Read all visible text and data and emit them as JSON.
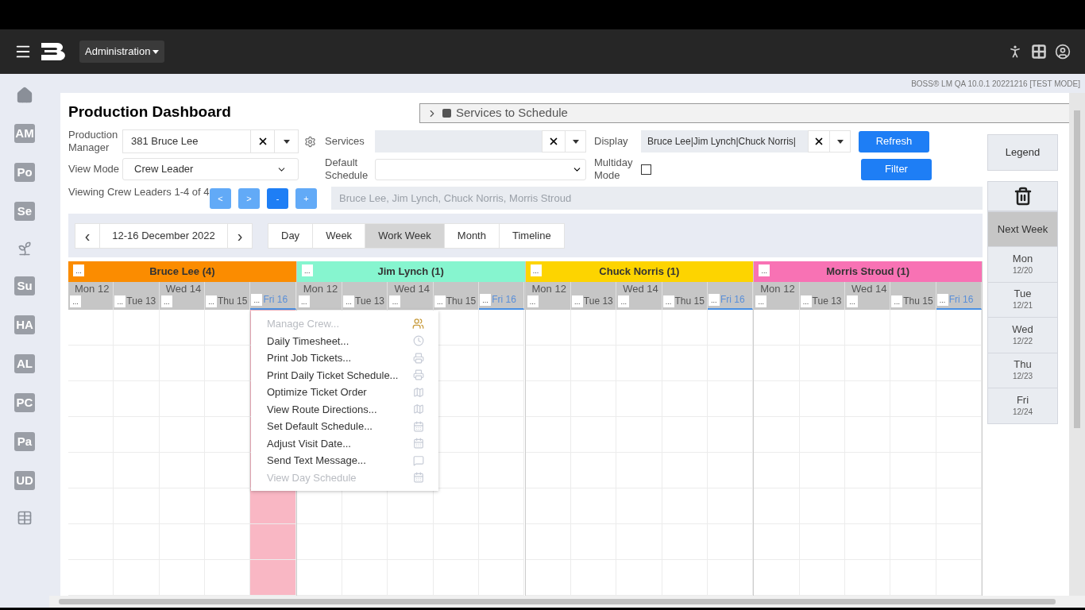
{
  "nav": {
    "menu": "Administration"
  },
  "version": "BOSS® LM QA 10.0.1 20221216 [TEST MODE]",
  "sidebar": [
    {
      "kind": "home"
    },
    {
      "kind": "text",
      "label": "AM"
    },
    {
      "kind": "text",
      "label": "Po"
    },
    {
      "kind": "text",
      "label": "Se"
    },
    {
      "kind": "sprout"
    },
    {
      "kind": "text",
      "label": "Su"
    },
    {
      "kind": "text",
      "label": "HA"
    },
    {
      "kind": "text",
      "label": "AL"
    },
    {
      "kind": "text",
      "label": "PC"
    },
    {
      "kind": "text",
      "label": "Pa"
    },
    {
      "kind": "text",
      "label": "UD"
    },
    {
      "kind": "grid"
    }
  ],
  "title": "Production Dashboard",
  "services_panel": {
    "title": "Services to Schedule",
    "expanded": false
  },
  "form": {
    "production_manager": {
      "label": "Production Manager",
      "value": "381 Bruce Lee"
    },
    "view_mode": {
      "label": "View Mode",
      "value": "Crew Leader"
    },
    "services": {
      "label": "Services"
    },
    "default_schedule": {
      "label": "Default Schedule"
    },
    "display": {
      "label": "Display",
      "value": "Bruce Lee|Jim Lynch|Chuck Norris|"
    },
    "multiday": {
      "label": "Multiday Mode",
      "checked": false
    },
    "refresh": "Refresh",
    "filter": "Filter"
  },
  "viewing": {
    "text": "Viewing Crew Leaders 1-4 of 4",
    "buttons": [
      {
        "label": "<",
        "kind": "light"
      },
      {
        "label": ">",
        "kind": "light"
      },
      {
        "label": "-",
        "kind": "dark"
      },
      {
        "label": "+",
        "kind": "light"
      }
    ],
    "names": "Bruce Lee, Jim Lynch, Chuck Norris, Morris Stroud"
  },
  "date_nav": {
    "prev": "‹",
    "range": "12-16 December 2022",
    "next": "›"
  },
  "views": [
    {
      "label": "Day",
      "selected": false
    },
    {
      "label": "Week",
      "selected": false
    },
    {
      "label": "Work Week",
      "selected": true
    },
    {
      "label": "Month",
      "selected": false
    },
    {
      "label": "Timeline",
      "selected": false
    }
  ],
  "crews": [
    {
      "name": "Bruce Lee (4)",
      "color": "#fb8c00",
      "days": [
        {
          "label": "Mon 12",
          "kind": "below",
          "selected": false,
          "highlighted": false
        },
        {
          "label": "Tue 13",
          "kind": "before",
          "selected": false,
          "highlighted": false
        },
        {
          "label": "Wed 14",
          "kind": "below",
          "selected": false,
          "highlighted": false
        },
        {
          "label": "Thu 15",
          "kind": "before",
          "selected": false,
          "highlighted": false
        },
        {
          "label": "Fri 16",
          "kind": "before",
          "selected": true,
          "highlighted": true
        }
      ]
    },
    {
      "name": "Jim Lynch (1)",
      "color": "#86f5cf",
      "days": [
        {
          "label": "Mon 12",
          "kind": "below",
          "selected": false,
          "highlighted": false
        },
        {
          "label": "Tue 13",
          "kind": "before",
          "selected": false,
          "highlighted": false
        },
        {
          "label": "Wed 14",
          "kind": "below",
          "selected": false,
          "highlighted": false
        },
        {
          "label": "Thu 15",
          "kind": "before",
          "selected": false,
          "highlighted": false
        },
        {
          "label": "Fri 16",
          "kind": "before",
          "selected": true,
          "highlighted": false
        }
      ]
    },
    {
      "name": "Chuck Norris (1)",
      "color": "#fdd400",
      "days": [
        {
          "label": "Mon 12",
          "kind": "below",
          "selected": false,
          "highlighted": false
        },
        {
          "label": "Tue 13",
          "kind": "before",
          "selected": false,
          "highlighted": false
        },
        {
          "label": "Wed 14",
          "kind": "below",
          "selected": false,
          "highlighted": false
        },
        {
          "label": "Thu 15",
          "kind": "before",
          "selected": false,
          "highlighted": false
        },
        {
          "label": "Fri 16",
          "kind": "before",
          "selected": true,
          "highlighted": false
        }
      ]
    },
    {
      "name": "Morris Stroud (1)",
      "color": "#f872b4",
      "days": [
        {
          "label": "Mon 12",
          "kind": "below",
          "selected": false,
          "highlighted": false
        },
        {
          "label": "Tue 13",
          "kind": "before",
          "selected": false,
          "highlighted": false
        },
        {
          "label": "Wed 14",
          "kind": "below",
          "selected": false,
          "highlighted": false
        },
        {
          "label": "Thu 15",
          "kind": "before",
          "selected": false,
          "highlighted": false
        },
        {
          "label": "Fri 16",
          "kind": "before",
          "selected": true,
          "highlighted": false
        }
      ]
    }
  ],
  "more_label": "...",
  "context_menu": [
    {
      "label": "Manage Crew...",
      "kind": "crew",
      "disabled": true
    },
    {
      "label": "Daily Timesheet...",
      "kind": "clock",
      "disabled": false
    },
    {
      "label": "Print Job Tickets...",
      "kind": "printer",
      "disabled": false
    },
    {
      "label": "Print Daily Ticket Schedule...",
      "kind": "printer",
      "disabled": false
    },
    {
      "label": "Optimize Ticket Order",
      "kind": "map",
      "disabled": false
    },
    {
      "label": "View Route Directions...",
      "kind": "map",
      "disabled": false
    },
    {
      "label": "Set Default Schedule...",
      "kind": "calendar",
      "disabled": false
    },
    {
      "label": "Adjust Visit Date...",
      "kind": "calendar",
      "disabled": false
    },
    {
      "label": "Send Text Message...",
      "kind": "message",
      "disabled": false
    },
    {
      "label": "View Day Schedule",
      "kind": "calendar",
      "disabled": true
    }
  ],
  "right_panel": {
    "legend": "Legend",
    "next_week": {
      "label": "Next Week",
      "selected": true
    },
    "days": [
      {
        "day": "Mon",
        "date": "12/20"
      },
      {
        "day": "Tue",
        "date": "12/21"
      },
      {
        "day": "Wed",
        "date": "12/22"
      },
      {
        "day": "Thu",
        "date": "12/23"
      },
      {
        "day": "Fri",
        "date": "12/24"
      }
    ]
  }
}
